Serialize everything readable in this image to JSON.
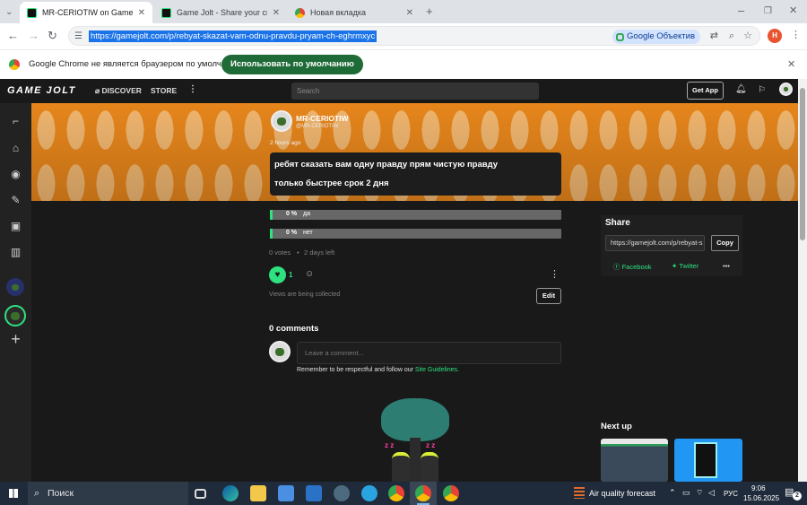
{
  "browser": {
    "tabs": [
      {
        "title": "MR-CERIOTIW on Game Jolt: \"p",
        "active": true
      },
      {
        "title": "Game Jolt - Share your creatio",
        "active": false
      },
      {
        "title": "Новая вкладка",
        "active": false
      }
    ],
    "url": "https://gamejolt.com/p/rebyat-skazat-vam-odnu-pravdu-pryam-ch-eghrmxyc",
    "lens_label": "Google Объектив",
    "profile_initial": "H",
    "infobar_text": "Google Chrome не является браузером по умолчанию.",
    "infobar_button": "Использовать по умолчанию"
  },
  "gj": {
    "logo": "GAME JOLT",
    "discover": "DISCOVER",
    "store": "STORE",
    "search_placeholder": "Search",
    "get_app": "Get App"
  },
  "post": {
    "author": "MR-CERIOTIW",
    "handle": "@MR-CERIOTIW",
    "time": "2 hours ago",
    "line1": "ребят сказать вам одну правду прям чистую правду",
    "line2": "только быстрее срок 2 дня",
    "poll": [
      {
        "percent": "0 %",
        "label": "да",
        "fraction": 0
      },
      {
        "percent": "0 %",
        "label": "нет",
        "fraction": 0
      }
    ],
    "votes": "0 votes",
    "sep": "•",
    "remaining": "2 days left",
    "likes": "1",
    "views_note": "Views are being collected",
    "edit": "Edit"
  },
  "comments": {
    "title": "0 comments",
    "placeholder": "Leave a comment...",
    "rules_prefix": "Remember to be respectful and follow our ",
    "rules_link": "Site Guidelines."
  },
  "share": {
    "title": "Share",
    "url": "https://gamejolt.com/p/rebyat-s",
    "copy": "Copy",
    "facebook": "Facebook",
    "twitter": "Twitter"
  },
  "next_up": "Next up",
  "taskbar": {
    "search": "Поиск",
    "weather": "Air quality forecast",
    "lang": "РУС",
    "time": "9:06",
    "date": "15.06.2025",
    "notif_count": "2"
  },
  "colors": {
    "accent": "#2de27f",
    "banner": "#e68a1e",
    "chrome_button": "#1f6b37"
  }
}
